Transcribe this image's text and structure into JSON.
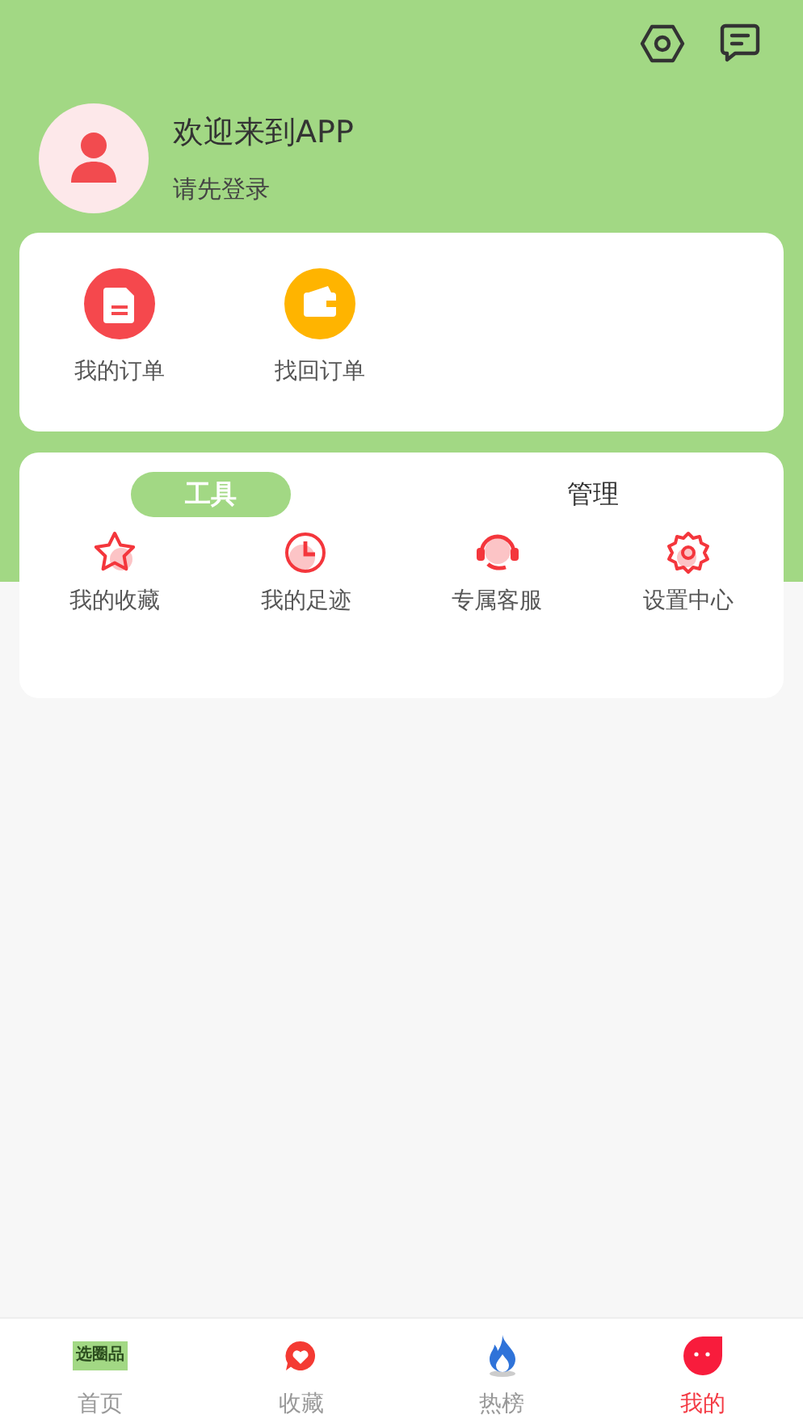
{
  "header": {
    "title": "欢迎来到APP",
    "subtitle": "请先登录"
  },
  "orders": [
    {
      "kind": "doc",
      "label": "我的订单"
    },
    {
      "kind": "wallet",
      "label": "找回订单"
    }
  ],
  "tabs": [
    {
      "label": "工具",
      "selected": true
    },
    {
      "label": "管理",
      "selected": false
    }
  ],
  "tools": [
    {
      "kind": "star",
      "label": "我的收藏"
    },
    {
      "kind": "clock",
      "label": "我的足迹"
    },
    {
      "kind": "headset",
      "label": "专属客服"
    },
    {
      "kind": "gear",
      "label": "设置中心"
    }
  ],
  "nav": [
    {
      "kind": "logo",
      "logo_text": "选圈品",
      "label": "首页",
      "selected": false
    },
    {
      "kind": "heart",
      "label": "收藏",
      "selected": false
    },
    {
      "kind": "flame",
      "label": "热榜",
      "selected": false
    },
    {
      "kind": "face",
      "label": "我的",
      "selected": true
    }
  ]
}
